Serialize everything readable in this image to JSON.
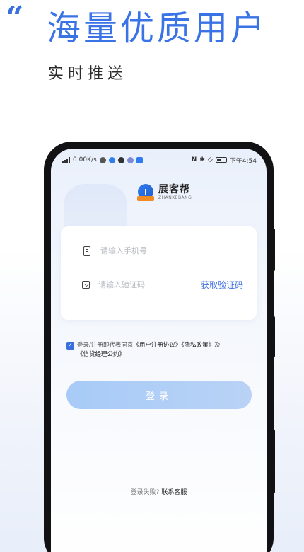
{
  "banner": {
    "quote": "“",
    "headline": "海量优质用户",
    "subline": "实时推送"
  },
  "statusbar": {
    "speed": "0.00K/s",
    "time": "下午4:54"
  },
  "app": {
    "name_cn": "展客帮",
    "name_en": "ZHANKEBANG",
    "badge": "i"
  },
  "form": {
    "phone_placeholder": "请输入手机号",
    "code_placeholder": "请输入验证码",
    "get_code": "获取验证码"
  },
  "agreement": {
    "checked": true,
    "check_glyph": "✓",
    "prefix": "登录/注册即代表同意",
    "user_agreement": "《用户注册协议》",
    "privacy": "《隐私政策》",
    "and": "及",
    "broker": "《信贷经理公约》"
  },
  "login_label": "登录",
  "fail": {
    "text": "登录失败?",
    "contact": "联系客服"
  },
  "colors": {
    "accent": "#3a6fe0",
    "button": "#a7cbf7"
  }
}
